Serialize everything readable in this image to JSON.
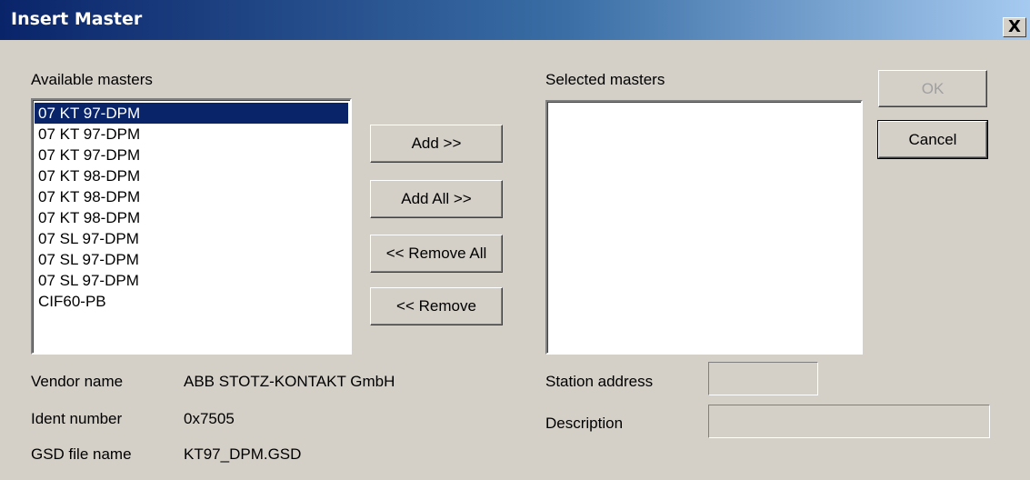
{
  "window": {
    "title": "Insert Master",
    "close_label": "X"
  },
  "available": {
    "label": "Available masters",
    "items": [
      "07 KT 97-DPM",
      "07 KT 97-DPM",
      "07 KT 97-DPM",
      "07 KT 98-DPM",
      "07 KT 98-DPM",
      "07 KT 98-DPM",
      "07 SL 97-DPM",
      "07 SL 97-DPM",
      "07 SL 97-DPM",
      "CIF60-PB"
    ],
    "selected_index": 0
  },
  "selected": {
    "label": "Selected masters",
    "items": []
  },
  "buttons": {
    "add": "Add >>",
    "add_all": "Add All >>",
    "remove_all": "<< Remove All",
    "remove": "<< Remove",
    "ok": "OK",
    "cancel": "Cancel"
  },
  "info": {
    "vendor_label": "Vendor name",
    "vendor_value": "ABB STOTZ-KONTAKT GmbH",
    "ident_label": "Ident number",
    "ident_value": "0x7505",
    "gsd_label": "GSD file name",
    "gsd_value": "KT97_DPM.GSD"
  },
  "station": {
    "address_label": "Station address",
    "address_value": "",
    "description_label": "Description",
    "description_value": ""
  }
}
